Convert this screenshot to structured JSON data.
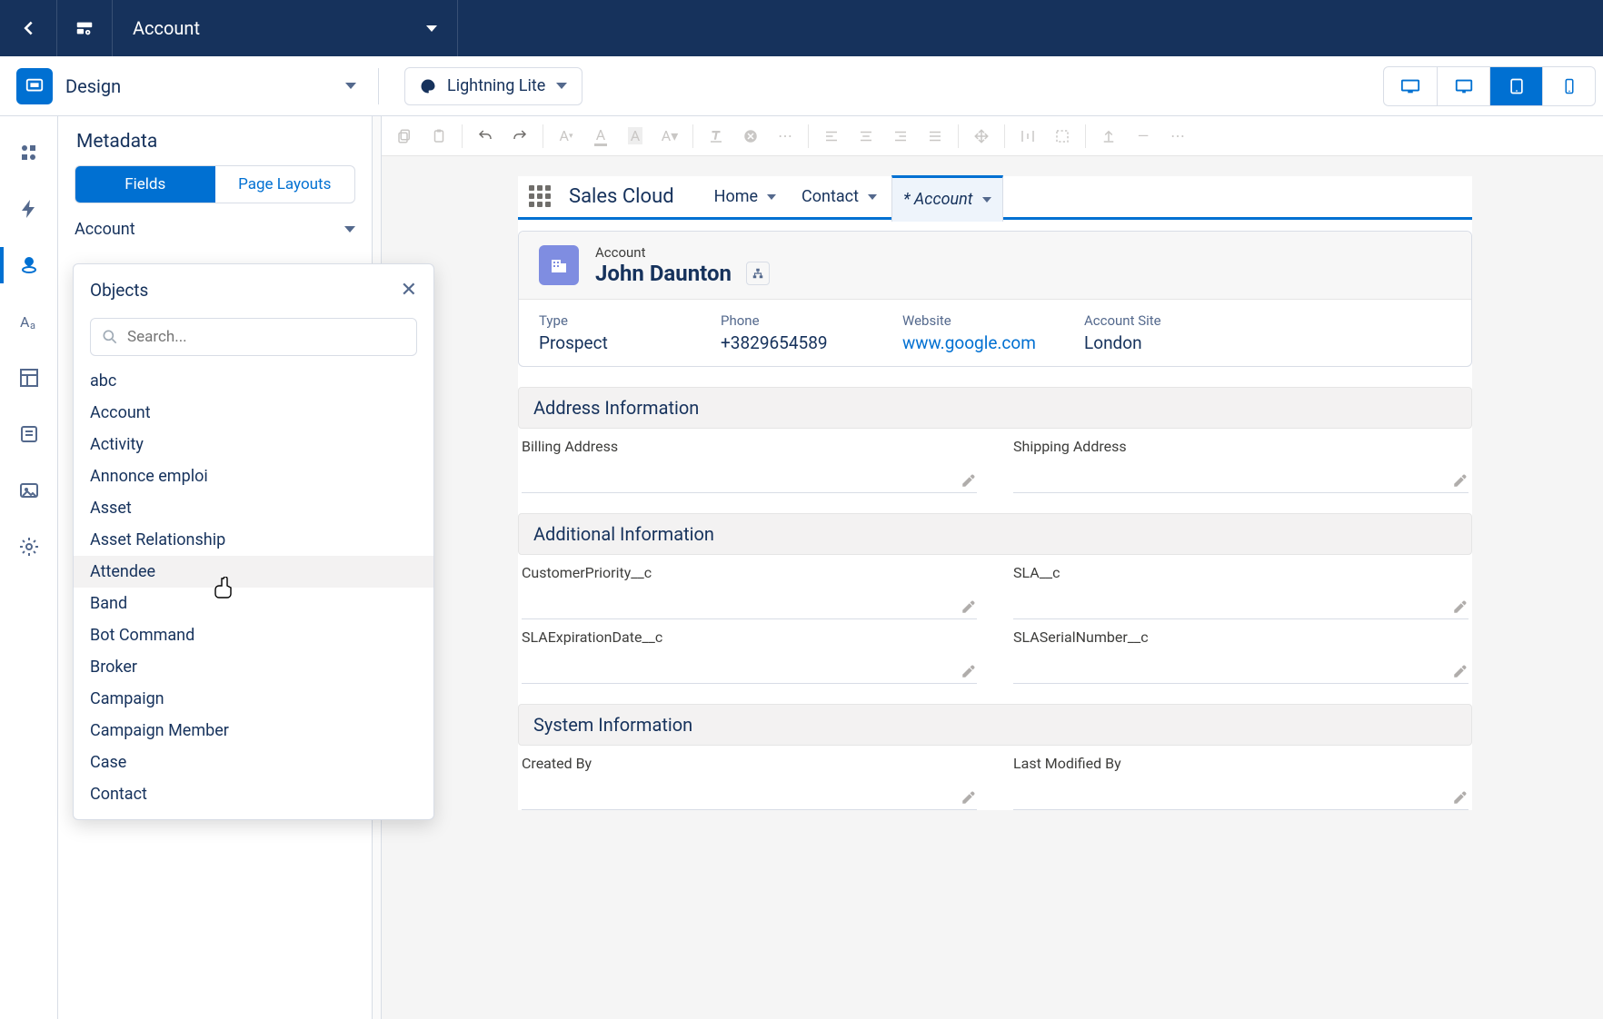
{
  "topnav": {
    "object_label": "Account"
  },
  "secondbar": {
    "design_label": "Design",
    "theme_label": "Lightning Lite"
  },
  "sidebar": {
    "title": "Metadata",
    "tab_fields": "Fields",
    "tab_layouts": "Page Layouts",
    "selected_object": "Account"
  },
  "popover": {
    "title": "Objects",
    "search_placeholder": "Search...",
    "items": [
      "abc",
      "Account",
      "Activity",
      "Annonce emploi",
      "Asset",
      "Asset Relationship",
      "Attendee",
      "Band",
      "Bot Command",
      "Broker",
      "Campaign",
      "Campaign Member",
      "Case",
      "Contact"
    ],
    "hovered_index": 6
  },
  "preview": {
    "app_name": "Sales Cloud",
    "tabs": [
      {
        "label": "Home"
      },
      {
        "label": "Contact"
      },
      {
        "label": "* Account",
        "active": true
      }
    ],
    "record": {
      "type_label": "Account",
      "name": "John Daunton",
      "fields": [
        {
          "label": "Type",
          "value": "Prospect"
        },
        {
          "label": "Phone",
          "value": "+3829654589"
        },
        {
          "label": "Website",
          "value": "www.google.com",
          "link": true
        },
        {
          "label": "Account Site",
          "value": "London"
        }
      ]
    },
    "sections": [
      {
        "title": "Address Information",
        "rows": [
          [
            "Billing Address",
            "Shipping Address"
          ]
        ]
      },
      {
        "title": "Additional Information",
        "rows": [
          [
            "CustomerPriority__c",
            "SLA__c"
          ],
          [
            "SLAExpirationDate__c",
            "SLASerialNumber__c"
          ]
        ]
      },
      {
        "title": "System Information",
        "rows": [
          [
            "Created By",
            "Last Modified By"
          ]
        ]
      }
    ]
  }
}
